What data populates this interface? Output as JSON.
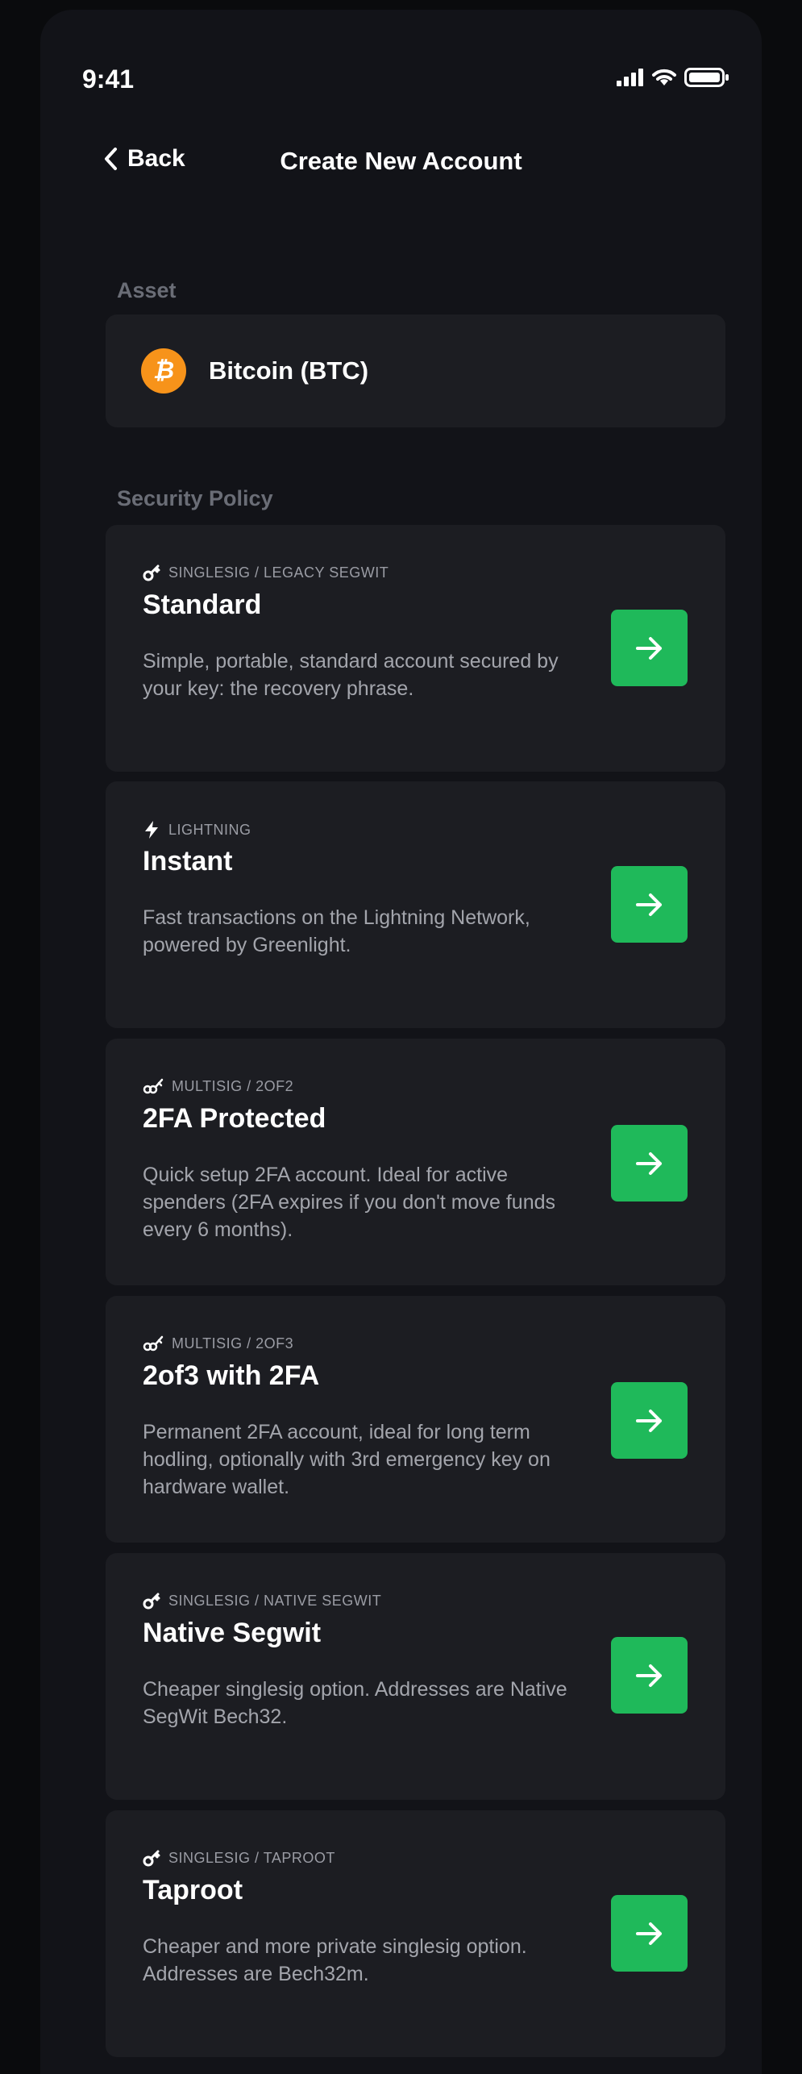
{
  "status": {
    "time": "9:41"
  },
  "nav": {
    "back_label": "Back",
    "title": "Create New Account"
  },
  "asset": {
    "section_label": "Asset",
    "name": "Bitcoin (BTC)",
    "icon": "bitcoin-icon",
    "icon_color": "#f7931a"
  },
  "security": {
    "section_label": "Security Policy",
    "policies": [
      {
        "tag": "SINGLESIG / LEGACY SEGWIT",
        "tag_icon": "key-icon",
        "title": "Standard",
        "description": "Simple, portable, standard account secured by your key: the recovery phrase."
      },
      {
        "tag": "LIGHTNING",
        "tag_icon": "lightning-icon",
        "title": "Instant",
        "description": "Fast transactions on the Lightning Network, powered by Greenlight."
      },
      {
        "tag": "MULTISIG / 2OF2",
        "tag_icon": "multi-key-icon",
        "title": "2FA Protected",
        "description": "Quick setup 2FA account. Ideal for active spenders (2FA expires if you don't move funds every 6 months)."
      },
      {
        "tag": "MULTISIG / 2OF3",
        "tag_icon": "multi-key-icon",
        "title": "2of3 with 2FA",
        "description": "Permanent 2FA account, ideal for long term hodling, optionally with 3rd emergency key on hardware wallet."
      },
      {
        "tag": "SINGLESIG / NATIVE SEGWIT",
        "tag_icon": "key-icon",
        "title": "Native Segwit",
        "description": "Cheaper singlesig option. Addresses are Native SegWit Bech32."
      },
      {
        "tag": "SINGLESIG / TAPROOT",
        "tag_icon": "key-icon",
        "title": "Taproot",
        "description": "Cheaper and more private singlesig option. Addresses are Bech32m."
      }
    ]
  },
  "colors": {
    "accent_green": "#1fb95a",
    "card_background": "#1c1d22",
    "screen_background": "#121318"
  }
}
